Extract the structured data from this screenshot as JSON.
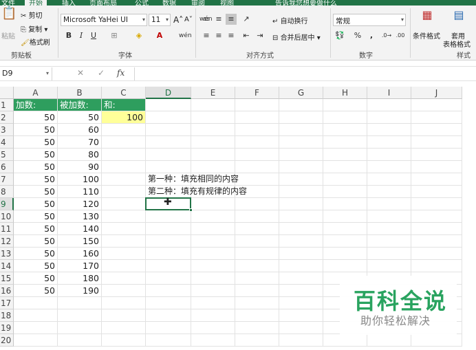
{
  "ribbon_tabs": [
    "文件",
    "开始",
    "插入",
    "页面布局",
    "公式",
    "数据",
    "审阅",
    "视图",
    "告诉我您想要做什么"
  ],
  "clipboard": {
    "paste": "粘贴",
    "cut": "剪切",
    "copy": "复制",
    "format_painter": "格式刷",
    "label": "剪贴板"
  },
  "font": {
    "name": "Microsoft YaHei UI",
    "size": "11",
    "label": "字体",
    "grow": "A",
    "shrink": "A",
    "bold": "B",
    "italic": "I",
    "underline": "U"
  },
  "alignment": {
    "wrap": "自动换行",
    "merge": "合并后居中",
    "label": "对齐方式"
  },
  "number": {
    "format": "常规",
    "percent": "%",
    "comma": ",",
    "label": "数字"
  },
  "styles": {
    "conditional": "条件格式",
    "table_line1": "套用",
    "table_line2": "表格格式",
    "label": "样式"
  },
  "namebox": "D9",
  "formula_value": "",
  "columns": [
    "A",
    "B",
    "C",
    "D",
    "E",
    "F",
    "G",
    "H",
    "I",
    "J"
  ],
  "rows": [
    "1",
    "2",
    "3",
    "4",
    "5",
    "6",
    "7",
    "8",
    "9",
    "10",
    "11",
    "12",
    "13",
    "14",
    "15",
    "16",
    "17",
    "18",
    "19",
    "20"
  ],
  "selected_cell": "D9",
  "headers": {
    "a1": "加数:",
    "b1": "被加数:",
    "c1": "和:"
  },
  "col_a": [
    "50",
    "50",
    "50",
    "50",
    "50",
    "50",
    "50",
    "50",
    "50",
    "50",
    "50",
    "50",
    "50",
    "50",
    "50"
  ],
  "col_b": [
    "50",
    "60",
    "70",
    "80",
    "90",
    "100",
    "110",
    "120",
    "130",
    "140",
    "150",
    "160",
    "170",
    "180",
    "190"
  ],
  "c2": "100",
  "notes": {
    "d7": "第一种：填充相同的内容",
    "d8": "第二种：填充有规律的内容"
  },
  "watermark": {
    "title": "百科全说",
    "subtitle": "助你轻松解决"
  },
  "colors": {
    "excel_green": "#217346",
    "header_fill": "#2e9e5e",
    "highlight": "#ffff99"
  }
}
